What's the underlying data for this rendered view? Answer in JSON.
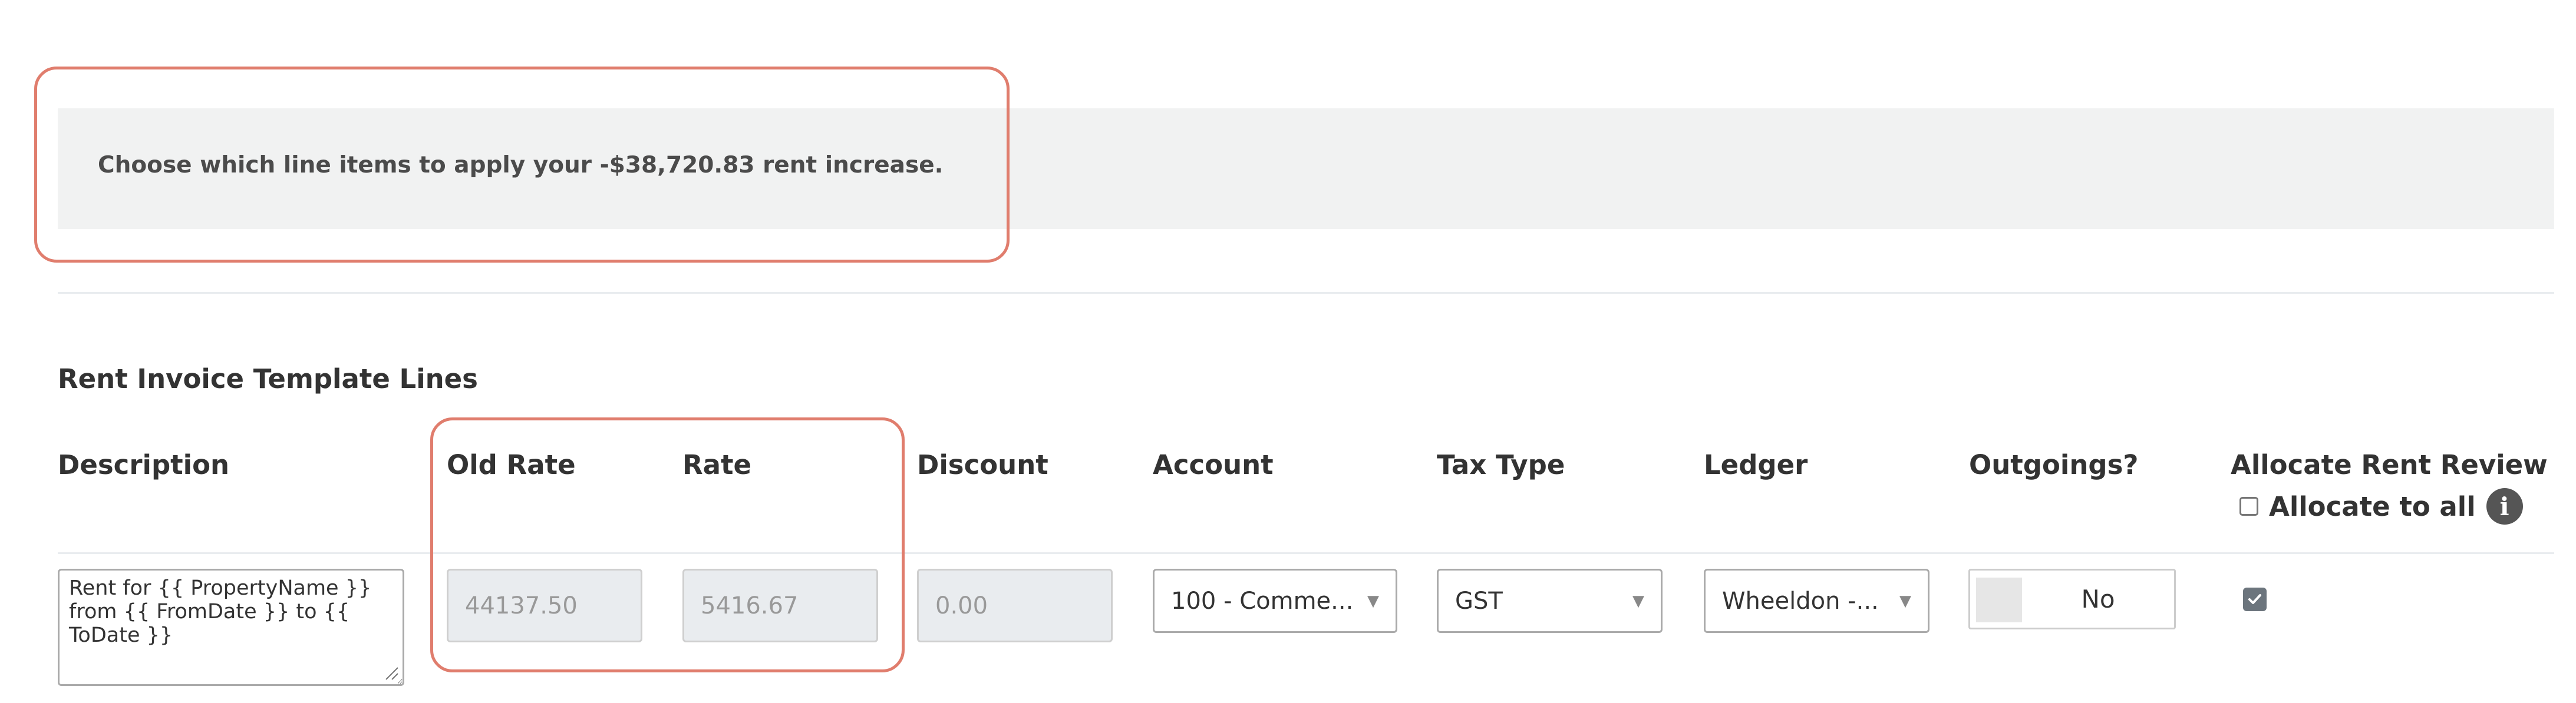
{
  "banner": {
    "message": "Choose which line items to apply your -$38,720.83 rent increase."
  },
  "section": {
    "title": "Rent Invoice Template Lines"
  },
  "columns": {
    "description": "Description",
    "old_rate": "Old Rate",
    "rate": "Rate",
    "discount": "Discount",
    "account": "Account",
    "tax_type": "Tax Type",
    "ledger": "Ledger",
    "outgoings": "Outgoings?",
    "allocate_rent_review": "Allocate Rent Review",
    "allocate_to_all": "Allocate to all"
  },
  "row": {
    "description": "Rent for {{ PropertyName }} from {{ FromDate }} to {{ ToDate }}",
    "old_rate": "44137.50",
    "rate": "5416.67",
    "discount": "0.00",
    "account": "100 - Comme...",
    "tax_type": "GST",
    "ledger": "Wheeldon -...",
    "outgoings": "No",
    "allocate_checked": true
  },
  "icons": {
    "info": "info-icon",
    "dropdown": "chevron-down-icon",
    "check": "checkmark-icon",
    "resize": "resize-grip-icon"
  },
  "colors": {
    "highlight": "#e07d6d",
    "banner_bg": "#f1f2f2",
    "disabled_bg": "#e9ecef"
  }
}
